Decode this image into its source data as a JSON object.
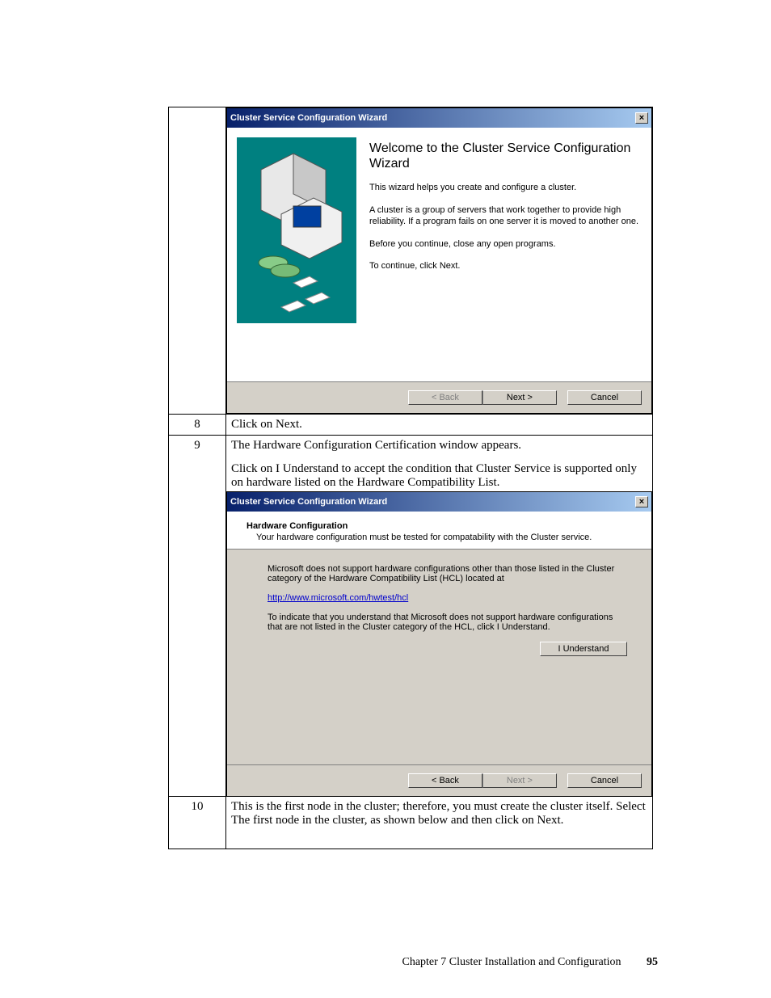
{
  "steps": {
    "s8": {
      "num": "8",
      "text": "Click on Next."
    },
    "s9": {
      "num": "9",
      "line1": "The Hardware Configuration Certification window appears.",
      "line2": "Click on I Understand to accept the condition that Cluster Service is supported only on hardware listed on the Hardware Compatibility List."
    },
    "s10": {
      "num": "10",
      "text": "This is the first node in the cluster; therefore, you must create the cluster itself. Select The first node in the cluster, as shown below and then click on Next."
    }
  },
  "dialog1": {
    "title": "Cluster Service Configuration Wizard",
    "close": "×",
    "heading": "Welcome to the Cluster Service Configuration Wizard",
    "p1": "This wizard helps you create and configure a cluster.",
    "p2": "A cluster is a group of servers that work together to provide high reliability. If a program fails on one server it is moved to another one.",
    "p3": "Before you continue, close any open programs.",
    "p4": "To continue, click Next.",
    "back": "< Back",
    "next": "Next >",
    "cancel": "Cancel"
  },
  "dialog2": {
    "title": "Cluster Service Configuration Wizard",
    "close": "×",
    "hdr_title": "Hardware Configuration",
    "hdr_sub": "Your hardware configuration must be tested for compatability with the Cluster service.",
    "p1": "Microsoft does not support hardware configurations other than those listed in the Cluster category of the Hardware Compatibility List (HCL) located at",
    "link": "http://www.microsoft.com/hwtest/hcl",
    "p2": "To indicate that you understand that Microsoft does not support hardware configurations that are not listed in the Cluster category of the HCL, click I Understand.",
    "understand": "I Understand",
    "back": "< Back",
    "next": "Next >",
    "cancel": "Cancel"
  },
  "footer": {
    "chapter": "Chapter 7 Cluster Installation and Configuration",
    "page": "95"
  }
}
